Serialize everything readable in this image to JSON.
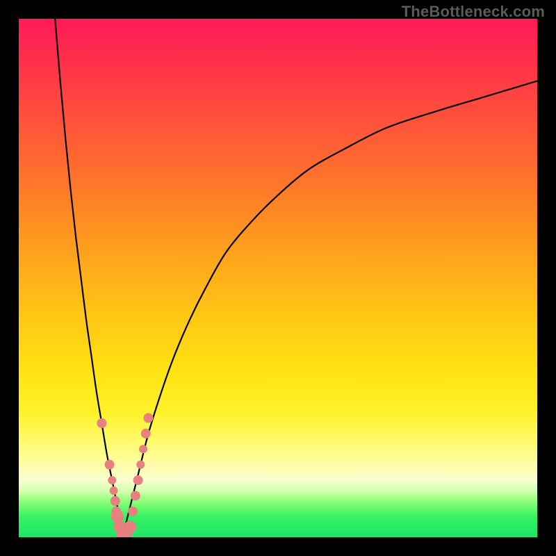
{
  "watermark": {
    "text": "TheBottleneck.com"
  },
  "chart_data": {
    "type": "line",
    "title": "",
    "xlabel": "",
    "ylabel": "",
    "xlim": [
      0,
      100
    ],
    "ylim": [
      0,
      100
    ],
    "grid": false,
    "legend": false,
    "background": "red-yellow-green vertical gradient",
    "series": [
      {
        "name": "left-branch",
        "x": [
          7,
          8,
          9,
          10,
          11,
          12,
          13,
          14,
          15,
          16,
          17,
          18,
          19,
          19.5,
          20
        ],
        "y": [
          100,
          88,
          77,
          67,
          58,
          50,
          42,
          35,
          28,
          22,
          16,
          11,
          6,
          3,
          0
        ]
      },
      {
        "name": "right-branch",
        "x": [
          20,
          21.5,
          23,
          25,
          27.5,
          30,
          33,
          36,
          40,
          45,
          50,
          56,
          63,
          71,
          80,
          90,
          100
        ],
        "y": [
          0,
          6,
          12,
          20,
          28,
          35,
          42,
          48,
          55,
          61,
          66,
          71,
          75,
          79,
          82,
          85,
          88
        ]
      }
    ],
    "markers": {
      "name": "highlighted-points",
      "color": "#e98080",
      "points": [
        {
          "x": 16.0,
          "y": 22,
          "r": 7
        },
        {
          "x": 17.5,
          "y": 14,
          "r": 7
        },
        {
          "x": 18.0,
          "y": 11,
          "r": 6
        },
        {
          "x": 18.3,
          "y": 9,
          "r": 6
        },
        {
          "x": 18.6,
          "y": 7,
          "r": 7
        },
        {
          "x": 18.8,
          "y": 5,
          "r": 7
        },
        {
          "x": 19.0,
          "y": 4,
          "r": 9
        },
        {
          "x": 19.5,
          "y": 2,
          "r": 9
        },
        {
          "x": 20.0,
          "y": 0.5,
          "r": 9
        },
        {
          "x": 20.8,
          "y": 1,
          "r": 9
        },
        {
          "x": 21.5,
          "y": 2,
          "r": 9
        },
        {
          "x": 22.0,
          "y": 5,
          "r": 7
        },
        {
          "x": 22.5,
          "y": 8,
          "r": 7
        },
        {
          "x": 23.0,
          "y": 11,
          "r": 7
        },
        {
          "x": 23.5,
          "y": 14,
          "r": 6
        },
        {
          "x": 24.0,
          "y": 17,
          "r": 6
        },
        {
          "x": 24.5,
          "y": 20,
          "r": 7
        },
        {
          "x": 25.0,
          "y": 23,
          "r": 7
        }
      ]
    }
  }
}
